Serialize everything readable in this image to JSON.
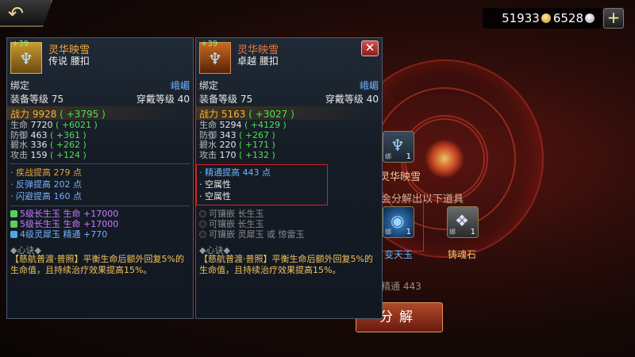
{
  "header": {
    "back_icon": "back-arrow-icon",
    "currency_gold": "51933",
    "currency_silver": "6528",
    "plus_label": "+"
  },
  "panels": [
    {
      "id": "left",
      "level_badge": "+39",
      "name": "灵华映雪",
      "sub": "传说 腰扣",
      "bind_label": "绑定",
      "bind_value": "峨嵋",
      "equip_level": "装备等级 75",
      "wear_level": "穿戴等级 40",
      "power_label": "战力",
      "power_value": "9928",
      "power_bonus": "( +3795 )",
      "stats": [
        {
          "name": "生命",
          "value": "7720",
          "bonus": "( +6021 )"
        },
        {
          "name": "防御",
          "value": "463",
          "bonus": "( +361 )"
        },
        {
          "name": "碧水",
          "value": "336",
          "bonus": "( +262 )"
        },
        {
          "name": "攻击",
          "value": "159",
          "bonus": "( +124 )"
        }
      ],
      "extras": [
        "· 疾战提高 279 点",
        "· 反弹提高 202 点",
        "· 闪避提高 160 点"
      ],
      "gems": [
        {
          "name": "5级长生玉",
          "attr": "生命 +17000"
        },
        {
          "name": "5级长生玉",
          "attr": "生命 +17000"
        },
        {
          "name": "4级灵犀玉",
          "attr": "精通 +770"
        }
      ],
      "xinjue_label": "◆心诀◆",
      "xinjue_text": "【慈航普渡·普照】平衡生命后额外回复5%的生命值，且持续治疗效果提高15%。"
    },
    {
      "id": "right",
      "level_badge": "+39",
      "name": "灵华映雪",
      "sub": "卓越 腰扣",
      "bind_label": "绑定",
      "bind_value": "峨嵋",
      "equip_level": "装备等级 75",
      "wear_level": "穿戴等级 40",
      "power_label": "战力",
      "power_value": "5163",
      "power_bonus": "( +3027 )",
      "stats": [
        {
          "name": "生命",
          "value": "5294",
          "bonus": "( +4129 )"
        },
        {
          "name": "防御",
          "value": "343",
          "bonus": "( +267 )"
        },
        {
          "name": "碧水",
          "value": "220",
          "bonus": "( +171 )"
        },
        {
          "name": "攻击",
          "value": "170",
          "bonus": "( +132 )"
        }
      ],
      "extras": [
        "· 精通提高 443 点",
        "· 空属性",
        "· 空属性"
      ],
      "gems": [
        "可镶嵌 长生玉",
        "可镶嵌 长生玉",
        "可镶嵌 灵犀玉 或 惊雷玉"
      ],
      "xinjue_label": "◆心诀◆",
      "xinjue_text": "【慈航普渡·普照】平衡生命后额外回复5%的生命值，且持续治疗效果提高15%。",
      "close_label": "✕"
    }
  ],
  "background": {
    "item_name": "灵华映雪",
    "hint": "会分解出以下道具",
    "slot_count": "1",
    "item1_name": "变天玉",
    "item2_name": "铸魂石",
    "stat_partial": "精通 443",
    "decompose_label": "分解"
  }
}
